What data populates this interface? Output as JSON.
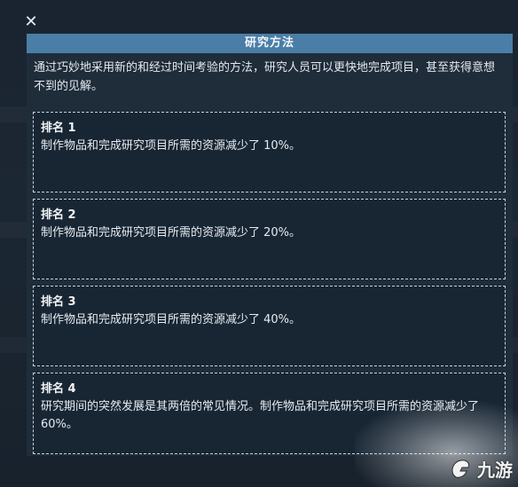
{
  "dialog": {
    "close_label": "✕",
    "title": "研究方法",
    "description": "通过巧妙地采用新的和经过时间考验的方法，研究人员可以更快地完成项目，甚至获得意想不到的见解。"
  },
  "ranks": [
    {
      "name": "排名 1",
      "effect": "制作物品和完成研究项目所需的资源减少了 10%。"
    },
    {
      "name": "排名 2",
      "effect": "制作物品和完成研究项目所需的资源减少了 20%。"
    },
    {
      "name": "排名 3",
      "effect": "制作物品和完成研究项目所需的资源减少了 40%。"
    },
    {
      "name": "排名 4",
      "effect": "研究期间的突然发展是其两倍的常见情况。制作物品和完成研究项目所需的资源减少了 60%。"
    }
  ],
  "watermark": {
    "text": "九游",
    "logo_icon": "jiuyou-logo-icon"
  },
  "colors": {
    "title_bar": "#4a7ea6",
    "panel_bg": "#1f2c3a",
    "card_border": "#c9d2dc"
  }
}
